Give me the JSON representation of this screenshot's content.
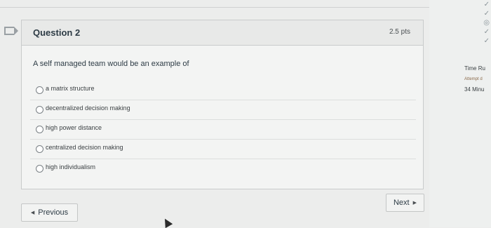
{
  "question": {
    "title": "Question 2",
    "points": "2.5 pts",
    "text": "A self managed team would be an example of",
    "answers": [
      {
        "label": "a matrix structure"
      },
      {
        "label": "decentralized decision making"
      },
      {
        "label": "high power distance"
      },
      {
        "label": "centralized decision making"
      },
      {
        "label": "high individualism"
      }
    ]
  },
  "nav": {
    "previous_label": "Previous",
    "next_label": "Next"
  },
  "sidebar": {
    "timer_title": "Time Ru",
    "timer_note": "Attempt d",
    "timer_value": "34 Minu",
    "icons": [
      "check-icon",
      "check-icon",
      "circle-icon",
      "check-icon",
      "check-icon"
    ]
  }
}
